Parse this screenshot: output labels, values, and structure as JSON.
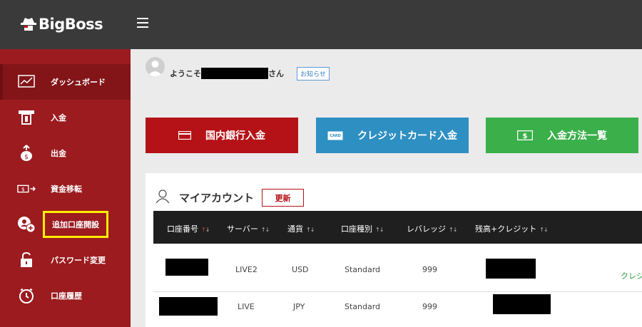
{
  "app": {
    "logo_text": "BigBoss"
  },
  "sidebar": {
    "items": [
      {
        "label": "ダッシュボード",
        "icon": "chart-monitor-icon"
      },
      {
        "label": "入金",
        "icon": "atm-deposit-icon"
      },
      {
        "label": "出金",
        "icon": "money-bag-withdraw-icon"
      },
      {
        "label": "資金移転",
        "icon": "money-transfer-icon"
      },
      {
        "label": "追加口座開設",
        "icon": "add-user-icon"
      },
      {
        "label": "パスワード変更",
        "icon": "unlock-icon"
      },
      {
        "label": "口座履歴",
        "icon": "clock-history-icon"
      }
    ]
  },
  "welcome": {
    "prefix": "ようこそ",
    "suffix": "さん",
    "notice_label": "お知らせ"
  },
  "actions": {
    "bank": "国内銀行入金",
    "card": "クレジットカード入金",
    "list": "入金方法一覧",
    "card_icon_text": "CARD"
  },
  "account": {
    "title": "マイアカウント",
    "refresh_label": "更新",
    "columns": [
      "口座番号",
      "サーバー",
      "通貨",
      "口座種別",
      "レバレッジ",
      "残高+クレジット"
    ],
    "rows": [
      {
        "server": "LIVE2",
        "currency": "USD",
        "type": "Standard",
        "leverage": "999",
        "extra": "クレジ"
      },
      {
        "server": "LIVE",
        "currency": "JPY",
        "type": "Standard",
        "leverage": "999",
        "extra": ""
      }
    ]
  },
  "colors": {
    "topbar": "#3a3a3a",
    "sidebar": "#9b1b1f",
    "bank_button": "#b51217",
    "card_button": "#2e8fc2",
    "list_button": "#3aaf4a",
    "highlight": "#ffee00"
  }
}
